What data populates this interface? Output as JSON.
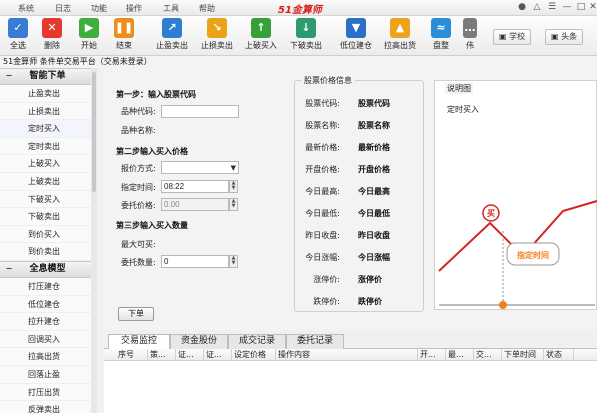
{
  "menubar": {
    "items": [
      "系统",
      "日志",
      "功能",
      "操作",
      "工具",
      "帮助"
    ],
    "brand": "51金算师"
  },
  "toolbar": {
    "buttons": [
      {
        "label": "全选",
        "icon": "select-all-icon",
        "color": "#3a7bd5"
      },
      {
        "label": "删除",
        "icon": "delete-icon",
        "color": "#e23b2e"
      },
      {
        "label": "开始",
        "icon": "play-icon",
        "color": "#3fae3a"
      },
      {
        "label": "结束",
        "icon": "pause-icon",
        "color": "#f08c1a"
      },
      {
        "label": "止盈卖出",
        "icon": "take-profit-icon",
        "color": "#2f7fd0"
      },
      {
        "label": "止损卖出",
        "icon": "stop-loss-icon",
        "color": "#e8a317"
      },
      {
        "label": "上破买入",
        "icon": "breakout-up-icon",
        "color": "#37a03a"
      },
      {
        "label": "下破卖出",
        "icon": "breakdown-icon",
        "color": "#2e9a70"
      },
      {
        "label": "低位建仓",
        "icon": "low-build-icon",
        "color": "#2b6fc7"
      },
      {
        "label": "拉高出货",
        "icon": "pump-sell-icon",
        "color": "#f0a21c"
      },
      {
        "label": "盘整",
        "icon": "consolidate-icon",
        "color": "#2a8fd6"
      },
      {
        "label": "伟",
        "icon": "more-icon",
        "color": "#7a7a7a"
      }
    ],
    "right_buttons": [
      {
        "label": "学校",
        "icon": "school-icon"
      },
      {
        "label": "头条",
        "icon": "headline-icon"
      }
    ]
  },
  "status_line": "51金算师 条件单交易平台（交易未登录）",
  "sidebar": {
    "group1": {
      "title": "智能下单",
      "items": [
        "止盈卖出",
        "止损卖出",
        "定时买入",
        "定时卖出",
        "上破买入",
        "上破卖出",
        "下破买入",
        "下破卖出",
        "到价买入",
        "到价卖出"
      ]
    },
    "group2": {
      "title": "全息模型",
      "items": [
        "打压建仓",
        "低位建仓",
        "拉升建仓",
        "回调买入",
        "拉高出货",
        "回落止盈",
        "打压出货",
        "反弹卖出"
      ]
    }
  },
  "form": {
    "step1": "第一步：输入股票代码",
    "code_label": "品种代码:",
    "code_value": "",
    "name_label": "品种名称:",
    "step2": "第二步输入买入价格",
    "price_mode_label": "报价方式:",
    "price_mode_value": "",
    "time_label": "指定时间:",
    "time_value": "08:22",
    "commission_label": "委托价格:",
    "commission_value": "0.00",
    "step3": "第三步输入买入数量",
    "max_buy_label": "最大可买:",
    "qty_label": "委托数量:",
    "qty_value": "0",
    "submit_label": "下单"
  },
  "quote": {
    "title": "股票价格信息",
    "rows": [
      {
        "k": "股票代码:",
        "v": "股票代码"
      },
      {
        "k": "股票名称:",
        "v": "股票名称"
      },
      {
        "k": "最新价格:",
        "v": "最新价格"
      },
      {
        "k": "开盘价格:",
        "v": "开盘价格"
      },
      {
        "k": "今日最高:",
        "v": "今日最高"
      },
      {
        "k": "今日最低:",
        "v": "今日最低"
      },
      {
        "k": "昨日收盘:",
        "v": "昨日收盘"
      },
      {
        "k": "今日涨幅:",
        "v": "今日涨幅"
      },
      {
        "k": "涨停价:",
        "v": "涨停价"
      },
      {
        "k": "跌停价:",
        "v": "跌停价"
      }
    ]
  },
  "diagram": {
    "title": "说明图",
    "subtitle": "定时买入",
    "buy_marker": "买",
    "callout": "指定时间",
    "line_color": "#d6241e",
    "accent": "#f07f1e"
  },
  "tabs": [
    "交易监控",
    "资金股份",
    "成交记录",
    "委托记录"
  ],
  "grid_headers": [
    "序号",
    "策...",
    "证...",
    "证...",
    "设定价格",
    "操作内容",
    "开...",
    "最...",
    "交...",
    "下单时间",
    "状态"
  ]
}
